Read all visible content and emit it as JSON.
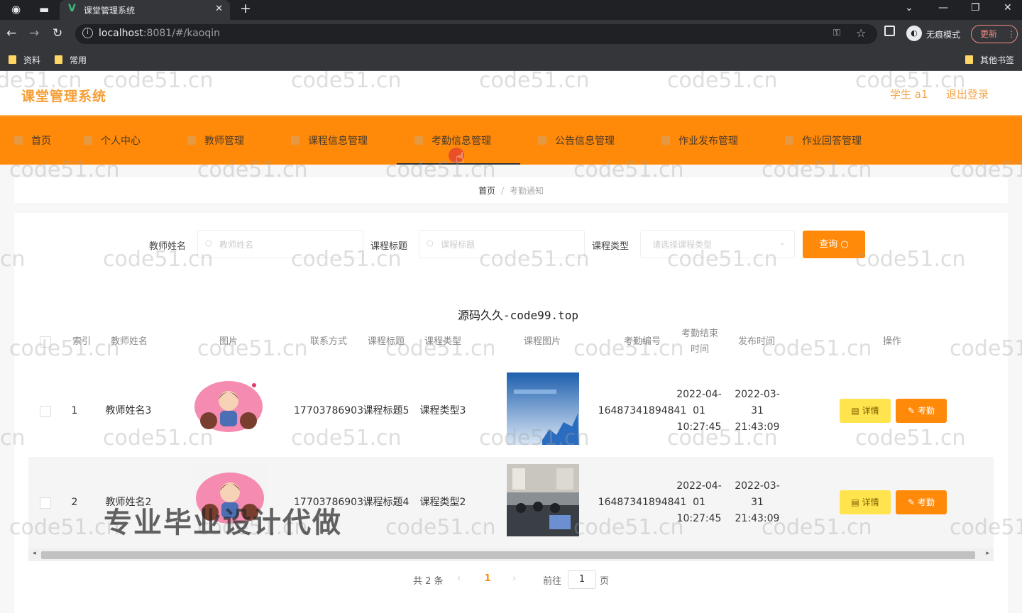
{
  "browser": {
    "tab_title": "课堂管理系统",
    "url_host": "localhost",
    "url_path": ":8081/#/kaoqin",
    "incognito_label": "无痕模式",
    "update_label": "更新",
    "bookmarks": [
      "资料",
      "常用"
    ],
    "other_bookmarks": "其他书签"
  },
  "header": {
    "brand": "课堂管理系统",
    "user": "学生 a1",
    "logout": "退出登录"
  },
  "menu": [
    {
      "label": "首页"
    },
    {
      "label": "个人中心"
    },
    {
      "label": "教师管理"
    },
    {
      "label": "课程信息管理"
    },
    {
      "label": "考勤信息管理",
      "active": true
    },
    {
      "label": "公告信息管理"
    },
    {
      "label": "作业发布管理"
    },
    {
      "label": "作业回答管理"
    }
  ],
  "breadcrumb": {
    "home": "首页",
    "current": "考勤通知"
  },
  "filters": {
    "teacher_label": "教师姓名",
    "teacher_placeholder": "教师姓名",
    "course_title_label": "课程标题",
    "course_title_placeholder": "课程标题",
    "course_type_label": "课程类型",
    "course_type_placeholder": "请选择课程类型",
    "query_button": "查询"
  },
  "site_name": "源码久久-code99.top",
  "table": {
    "columns": [
      "索引",
      "教师姓名",
      "图片",
      "联系方式",
      "课程标题",
      "课程类型",
      "课程图片",
      "考勤编号",
      "考勤结束时间",
      "发布时间",
      "操作"
    ],
    "rows": [
      {
        "index": "1",
        "teacher": "教师姓名3",
        "contact": "17703786903",
        "course_title": "课程标题5",
        "course_type": "课程类型3",
        "attendance_no": "16487341894841",
        "end_time": "2022-04-01 10:27:45",
        "publish_time": "2022-03-31 21:43:09",
        "detail_btn": "详情",
        "attend_btn": "考勤"
      },
      {
        "index": "2",
        "teacher": "教师姓名2",
        "contact": "17703786903",
        "course_title": "课程标题4",
        "course_type": "课程类型2",
        "attendance_no": "16487341894841",
        "end_time": "2022-04-01 10:27:45",
        "publish_time": "2022-03-31 21:43:09",
        "detail_btn": "详情",
        "attend_btn": "考勤"
      }
    ]
  },
  "pagination": {
    "total": "共 2 条",
    "current": "1",
    "goto": "前往",
    "page_input": "1",
    "page_suffix": "页"
  },
  "watermark": "code51.cn",
  "overlay_text": "专业毕业设计代做"
}
